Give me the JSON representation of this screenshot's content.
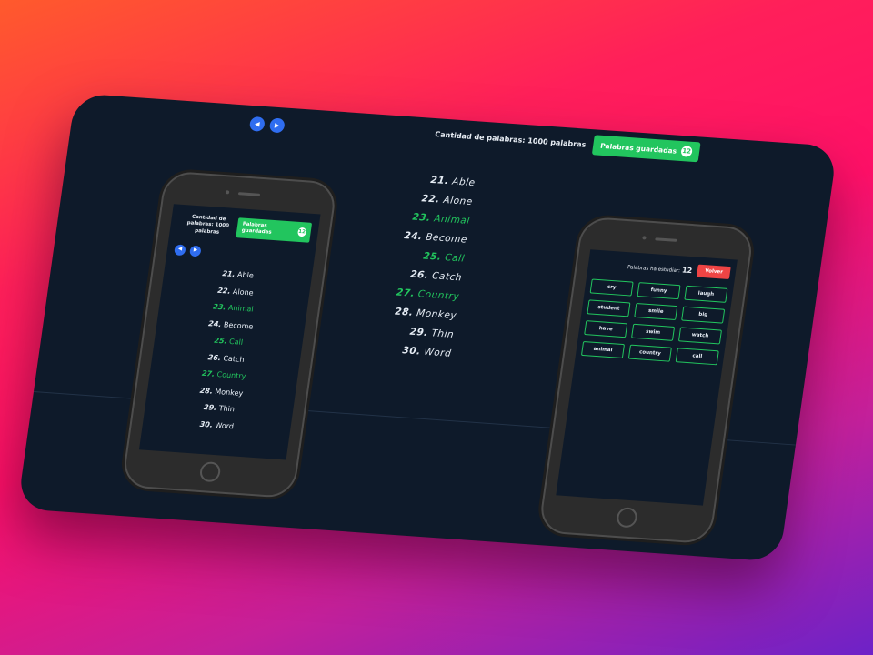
{
  "header": {
    "count_label": "Cantidad de palabras: 1000 palabras",
    "saved_label": "Palabras guardadas",
    "saved_count": "12",
    "prev_icon": "◀",
    "next_icon": "▶"
  },
  "words": [
    {
      "num": "21.",
      "word": "Able",
      "saved": false
    },
    {
      "num": "22.",
      "word": "Alone",
      "saved": false
    },
    {
      "num": "23.",
      "word": "Animal",
      "saved": true
    },
    {
      "num": "24.",
      "word": "Become",
      "saved": false
    },
    {
      "num": "25.",
      "word": "Call",
      "saved": true
    },
    {
      "num": "26.",
      "word": "Catch",
      "saved": false
    },
    {
      "num": "27.",
      "word": "Country",
      "saved": true
    },
    {
      "num": "28.",
      "word": "Monkey",
      "saved": false
    },
    {
      "num": "29.",
      "word": "Thin",
      "saved": false
    },
    {
      "num": "30.",
      "word": "Word",
      "saved": false
    }
  ],
  "mobile_left": {
    "count_label": "Cantidad de palabras: 1000 palabras",
    "saved_label": "Palabras guardadas",
    "saved_count": "12"
  },
  "mobile_right": {
    "studied_label": "Palabras ha estudiar:",
    "studied_count": "12",
    "back_label": "Volver",
    "chips": [
      "cry",
      "funny",
      "laugh",
      "student",
      "smile",
      "big",
      "have",
      "swim",
      "watch",
      "animal",
      "country",
      "call"
    ]
  },
  "colors": {
    "background": "#0e1a2a",
    "accent_green": "#22c55e",
    "accent_blue": "#2f6df0",
    "danger_red": "#ef4444"
  }
}
